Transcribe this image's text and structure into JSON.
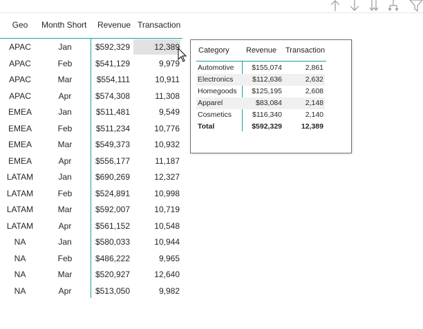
{
  "toolbar": {
    "icons": [
      "arrow-up-icon",
      "arrow-down-icon",
      "double-arrow-down-icon",
      "expand-all-down-icon",
      "filter-icon"
    ]
  },
  "main_table": {
    "headers": {
      "geo": "Geo",
      "month": "Month Short",
      "revenue": "Revenue",
      "transaction": "Transaction"
    },
    "rows": [
      {
        "geo": "APAC",
        "month": "Jan",
        "revenue": "$592,329",
        "transaction": "12,389"
      },
      {
        "geo": "APAC",
        "month": "Feb",
        "revenue": "$541,129",
        "transaction": "9,979"
      },
      {
        "geo": "APAC",
        "month": "Mar",
        "revenue": "$554,111",
        "transaction": "10,911"
      },
      {
        "geo": "APAC",
        "month": "Apr",
        "revenue": "$574,308",
        "transaction": "11,308"
      },
      {
        "geo": "EMEA",
        "month": "Jan",
        "revenue": "$511,481",
        "transaction": "9,549"
      },
      {
        "geo": "EMEA",
        "month": "Feb",
        "revenue": "$511,234",
        "transaction": "10,776"
      },
      {
        "geo": "EMEA",
        "month": "Mar",
        "revenue": "$549,373",
        "transaction": "10,932"
      },
      {
        "geo": "EMEA",
        "month": "Apr",
        "revenue": "$556,177",
        "transaction": "11,187"
      },
      {
        "geo": "LATAM",
        "month": "Jan",
        "revenue": "$690,269",
        "transaction": "12,327"
      },
      {
        "geo": "LATAM",
        "month": "Feb",
        "revenue": "$524,891",
        "transaction": "10,998"
      },
      {
        "geo": "LATAM",
        "month": "Mar",
        "revenue": "$592,007",
        "transaction": "10,719"
      },
      {
        "geo": "LATAM",
        "month": "Apr",
        "revenue": "$561,152",
        "transaction": "10,548"
      },
      {
        "geo": "NA",
        "month": "Jan",
        "revenue": "$580,033",
        "transaction": "10,944"
      },
      {
        "geo": "NA",
        "month": "Feb",
        "revenue": "$486,222",
        "transaction": "9,965"
      },
      {
        "geo": "NA",
        "month": "Mar",
        "revenue": "$520,927",
        "transaction": "12,640"
      },
      {
        "geo": "NA",
        "month": "Apr",
        "revenue": "$513,050",
        "transaction": "9,982"
      }
    ]
  },
  "tooltip": {
    "headers": {
      "category": "Category",
      "revenue": "Revenue",
      "transaction": "Transaction"
    },
    "rows": [
      {
        "category": "Automotive",
        "revenue": "$155,074",
        "transaction": "2,861"
      },
      {
        "category": "Electronics",
        "revenue": "$112,636",
        "transaction": "2,632"
      },
      {
        "category": "Homegoods",
        "revenue": "$125,195",
        "transaction": "2,608"
      },
      {
        "category": "Apparel",
        "revenue": "$83,084",
        "transaction": "2,148"
      },
      {
        "category": "Cosmetics",
        "revenue": "$116,340",
        "transaction": "2,140"
      }
    ],
    "total": {
      "category": "Total",
      "revenue": "$592,329",
      "transaction": "12,389"
    }
  },
  "colors": {
    "accent": "#1aa09b",
    "highlight": "#e1e1e1",
    "row_shade": "#f0f0f0",
    "border": "#707070"
  }
}
